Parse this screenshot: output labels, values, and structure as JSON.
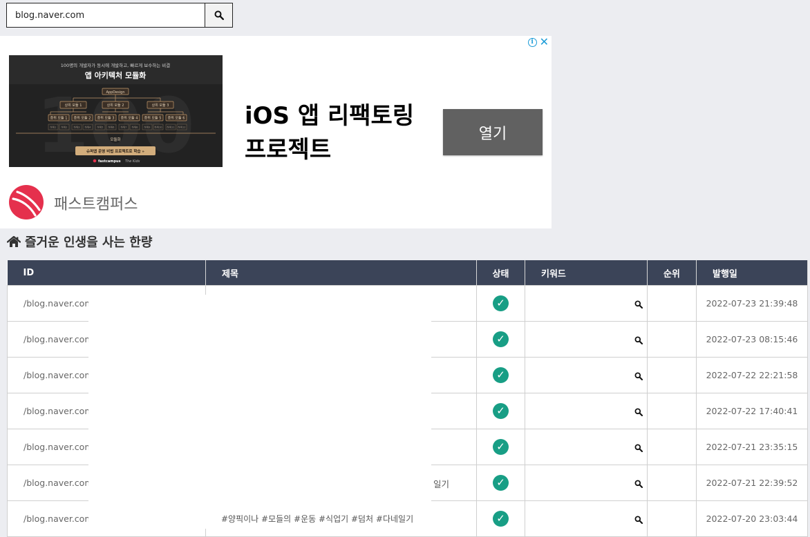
{
  "search": {
    "value": "blog.naver.com",
    "button_icon": "search-icon"
  },
  "ad": {
    "image": {
      "top_text": "100명의 개발자가 동시에 개발하고, 빠르게 보수하는 비결",
      "title": "앱 아키텍처 모듈화",
      "root": "AppDesign",
      "level1": [
        "상위 모듈 1",
        "상위 모듈 2",
        "상위 모듈 3"
      ],
      "level2": [
        "중위 모듈 1",
        "중위 모듈 2",
        "중위 모듈 3",
        "중위 모듈 4",
        "중위 모듈 5",
        "중위 모듈 6"
      ],
      "level3": [
        "하위1",
        "하위2",
        "하위3",
        "하위4",
        "하위5",
        "하위6",
        "하위7",
        "하위8",
        "하위9",
        "하위10",
        "하위11",
        "하위12"
      ],
      "bottom_label": "모듈화",
      "banner": "슈퍼앱 운영 비법 프로젝트로 학습 »",
      "brand1": "fastcampus",
      "brand2": "The Kids",
      "watermark": "100"
    },
    "headline_line1": "iOS 앱 리팩토링",
    "headline_line2": "프로젝트",
    "cta_label": "열기",
    "advertiser": "패스트캠퍼스",
    "info_icon": "info-icon",
    "close_icon": "close-icon"
  },
  "blog_title": "즐거운 인생을 사는 한량",
  "table": {
    "headers": {
      "id": "ID",
      "title": "제목",
      "status": "상태",
      "keyword": "키워드",
      "rank": "순위",
      "date": "발행일"
    },
    "rows": [
      {
        "id": "/blog.naver.com/l",
        "date": "2022-07-23 21:39:48"
      },
      {
        "id": "/blog.naver.com/l",
        "date": "2022-07-23 08:15:46"
      },
      {
        "id": "/blog.naver.com/l",
        "date": "2022-07-22 22:21:58"
      },
      {
        "id": "/blog.naver.com/l",
        "date": "2022-07-22 17:40:41"
      },
      {
        "id": "/blog.naver.com/l",
        "date": "2022-07-21 23:35:15"
      },
      {
        "id": "/blog.naver.com/l",
        "date": "2022-07-21 22:39:52"
      },
      {
        "id": "/blog.naver.com/l",
        "date": "2022-07-20 23:03:44"
      }
    ],
    "peek_text_row6": "일기",
    "peek_text_row7": "#양픽이나 #모들의 #운동 #식업기 #덤처 #다네일기"
  },
  "colors": {
    "header_bg": "#3b4458",
    "status_ok": "#189e85",
    "ad_cta_bg": "#616161",
    "brand_red": "#e5304d"
  }
}
